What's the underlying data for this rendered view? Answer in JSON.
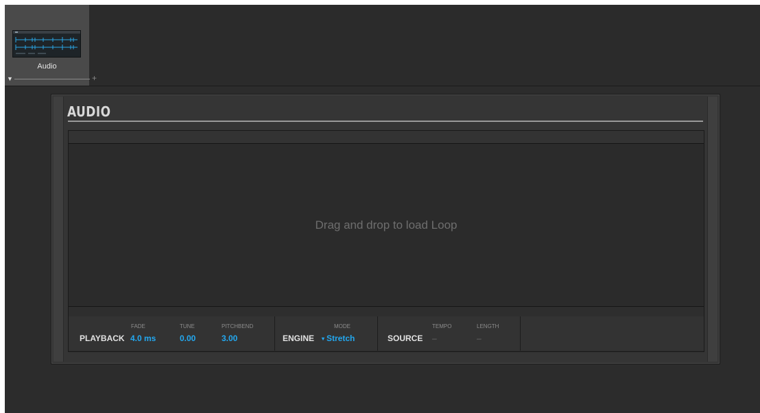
{
  "strip": {
    "slot_label": "Audio",
    "expand_arrow": "▼",
    "add_symbol": "+"
  },
  "panel": {
    "title": "AUDIO",
    "drop_hint": "Drag and drop to load Loop"
  },
  "params": {
    "playback": {
      "name": "PLAYBACK",
      "fade": {
        "label": "FADE",
        "value": "4.0 ms"
      },
      "tune": {
        "label": "TUNE",
        "value": "0.00"
      },
      "pitchbend": {
        "label": "PITCHBEND",
        "value": "3.00"
      }
    },
    "engine": {
      "name": "ENGINE",
      "mode": {
        "label": "MODE",
        "value": "Stretch",
        "arrow": "▾"
      }
    },
    "source": {
      "name": "SOURCE",
      "tempo": {
        "label": "TEMPO",
        "value": "–"
      },
      "length": {
        "label": "LENGTH",
        "value": "–"
      }
    }
  },
  "colors": {
    "accent": "#23a8f0",
    "background": "#2c2c2c",
    "panel": "#353535",
    "waveform": "#2aa7e8"
  },
  "icons": [
    "audio-plugin-thumbnail-icon",
    "expand-arrow-icon",
    "add-plugin-icon",
    "dropdown-arrow-icon"
  ]
}
